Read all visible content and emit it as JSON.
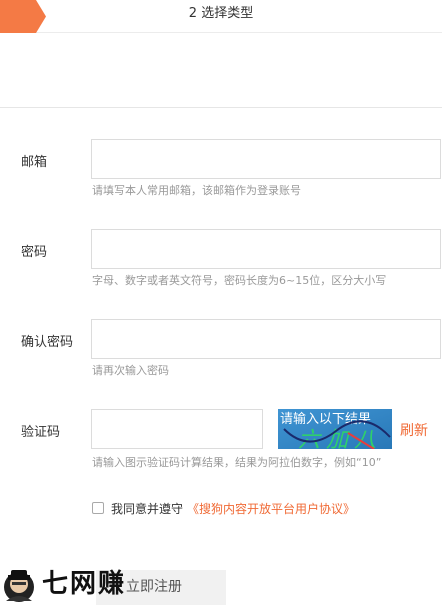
{
  "steps": {
    "current_label": "2 选择类型"
  },
  "form": {
    "email": {
      "label": "邮箱",
      "value": "",
      "hint": "请填写本人常用邮箱，该邮箱作为登录账号"
    },
    "password": {
      "label": "密码",
      "value": "",
      "hint": "字母、数字或者英文符号，密码长度为6~15位，区分大小写"
    },
    "confirm_password": {
      "label": "确认密码",
      "value": "",
      "hint": "请再次输入密码"
    },
    "captcha": {
      "label": "验证码",
      "value": "",
      "image_text": "请输入以下结果",
      "image_expression": "六加八",
      "refresh_label": "刷新",
      "hint": "请输入图示验证码计算结果，结果为阿拉伯数字，例如“10”"
    },
    "agreement": {
      "checked": false,
      "text": "我同意并遵守",
      "link_text": "《搜狗内容开放平台用户协议》"
    },
    "submit_label": "立即注册"
  },
  "watermark": {
    "text": "七网赚"
  },
  "colors": {
    "accent": "#f06a35",
    "captcha_bg": "#2f86c8",
    "hint": "#999999",
    "border": "#dcdcdc"
  }
}
